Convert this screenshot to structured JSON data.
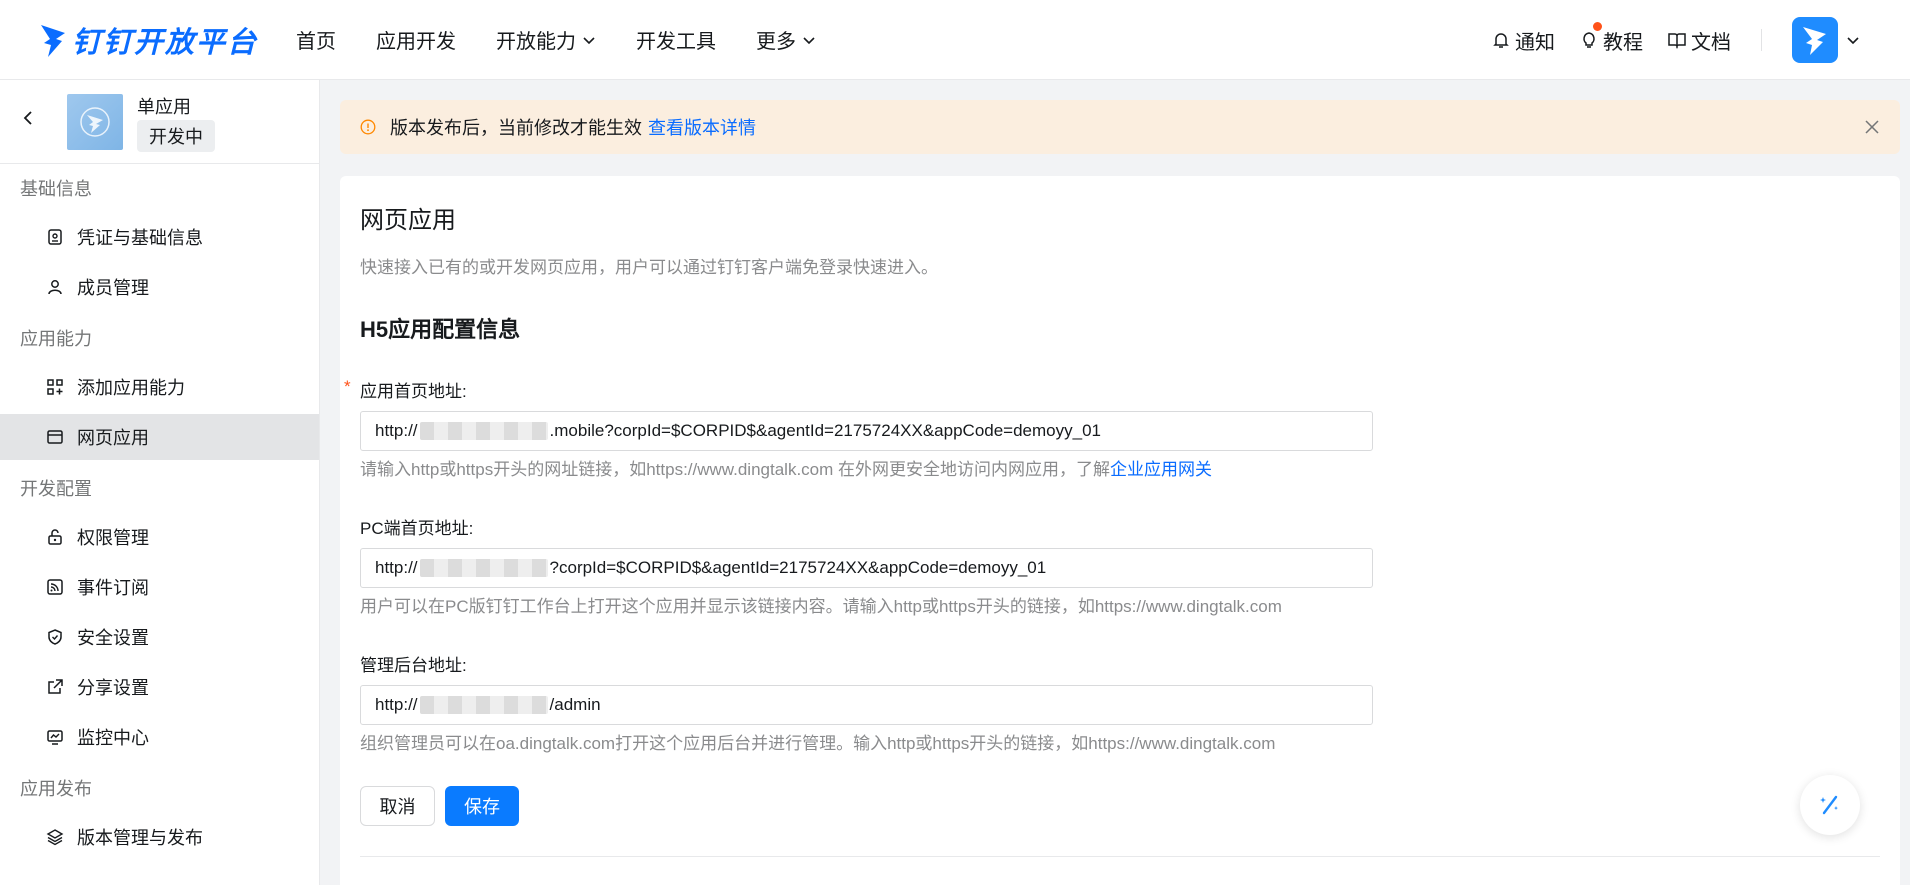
{
  "header": {
    "logo_text": "钉钉开放平台",
    "nav": [
      {
        "label": "首页",
        "has_dropdown": false
      },
      {
        "label": "应用开发",
        "has_dropdown": false
      },
      {
        "label": "开放能力",
        "has_dropdown": true
      },
      {
        "label": "开发工具",
        "has_dropdown": false
      },
      {
        "label": "更多",
        "has_dropdown": true
      }
    ],
    "right": {
      "notify_label": "通知",
      "tutorial_label": "教程",
      "docs_label": "文档"
    },
    "colors": {
      "brand": "#0a6cff",
      "badge": "#ff5219"
    }
  },
  "sidebar": {
    "app_name": "单应用",
    "app_status": "开发中",
    "groups": [
      {
        "title": "基础信息",
        "items": [
          {
            "label": "凭证与基础信息",
            "icon": "credential-icon"
          },
          {
            "label": "成员管理",
            "icon": "user-icon"
          }
        ]
      },
      {
        "title": "应用能力",
        "items": [
          {
            "label": "添加应用能力",
            "icon": "add-apps-icon"
          },
          {
            "label": "网页应用",
            "icon": "webpage-icon",
            "active": true
          }
        ]
      },
      {
        "title": "开发配置",
        "items": [
          {
            "label": "权限管理",
            "icon": "lock-icon"
          },
          {
            "label": "事件订阅",
            "icon": "rss-icon"
          },
          {
            "label": "安全设置",
            "icon": "shield-icon"
          },
          {
            "label": "分享设置",
            "icon": "share-icon"
          },
          {
            "label": "监控中心",
            "icon": "monitor-icon"
          }
        ]
      },
      {
        "title": "应用发布",
        "items": [
          {
            "label": "版本管理与发布",
            "icon": "layers-icon"
          }
        ]
      }
    ]
  },
  "notice": {
    "text": "版本发布后，当前修改才能生效",
    "link": "查看版本详情"
  },
  "main": {
    "title": "网页应用",
    "description": "快速接入已有的或开发网页应用，用户可以通过钉钉客户端免登录快速进入。",
    "section_title": "H5应用配置信息",
    "fields": [
      {
        "label": "应用首页地址:",
        "required": true,
        "value_prefix": "http://",
        "value_suffix": ".mobile?corpId=$CORPID$&agentId=2175724XX&appCode=demoyy_01",
        "help": "请输入http或https开头的网址链接，如https://www.dingtalk.com 在外网更安全地访问内网应用，了解",
        "help_link": "企业应用网关"
      },
      {
        "label": "PC端首页地址:",
        "required": false,
        "value_prefix": "http://",
        "value_suffix": "?corpId=$CORPID$&agentId=2175724XX&appCode=demoyy_01",
        "help": "用户可以在PC版钉钉工作台上打开这个应用并显示该链接内容。请输入http或https开头的链接，如https://www.dingtalk.com",
        "help_link": ""
      },
      {
        "label": "管理后台地址:",
        "required": false,
        "value_prefix": "http://",
        "value_suffix": "/admin",
        "help": "组织管理员可以在oa.dingtalk.com打开这个应用后台并进行管理。输入http或https开头的链接，如https://www.dingtalk.com",
        "help_link": ""
      }
    ],
    "cancel_label": "取消",
    "save_label": "保存"
  }
}
